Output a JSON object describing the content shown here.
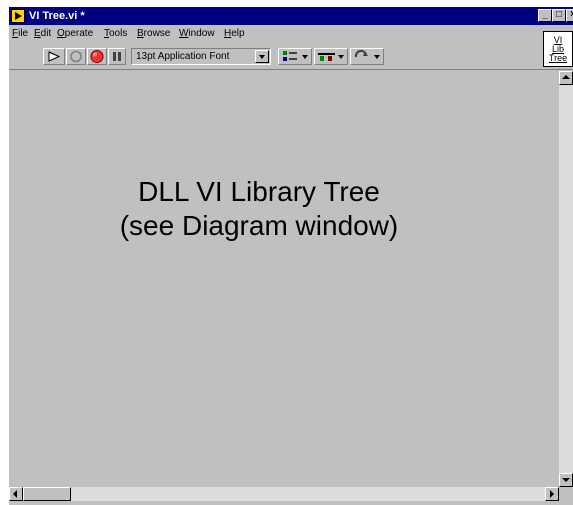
{
  "window": {
    "title": "VI Tree.vi *",
    "controls": {
      "minimize": "_",
      "maximize": "□",
      "close": "×"
    }
  },
  "menubar": {
    "items": [
      {
        "label": "File",
        "mnemonic": "F",
        "rest": "ile"
      },
      {
        "label": "Edit",
        "mnemonic": "E",
        "rest": "dit"
      },
      {
        "label": "Operate",
        "mnemonic": "O",
        "rest": "perate"
      },
      {
        "label": "Tools",
        "mnemonic": "T",
        "rest": "ools"
      },
      {
        "label": "Browse",
        "mnemonic": "B",
        "rest": "rowse"
      },
      {
        "label": "Window",
        "mnemonic": "W",
        "rest": "indow"
      },
      {
        "label": "Help",
        "mnemonic": "H",
        "rest": "elp"
      }
    ]
  },
  "toolbar": {
    "font_ring": "13pt Application Font",
    "icons": [
      "run-arrow-icon",
      "run-continuously-icon",
      "abort-icon",
      "pause-icon",
      "align-objects-icon",
      "distribute-objects-icon",
      "reorder-icon"
    ]
  },
  "vi_icon": {
    "lines": [
      "VI",
      "Lib",
      "Tree"
    ]
  },
  "panel": {
    "line1": "DLL VI Library Tree",
    "line2": "(see Diagram window)"
  },
  "colors": {
    "titlebar": "#000080",
    "panel": "#c0c0c0",
    "abort": "#ff3030",
    "icon_yellow": "#ffd200"
  }
}
